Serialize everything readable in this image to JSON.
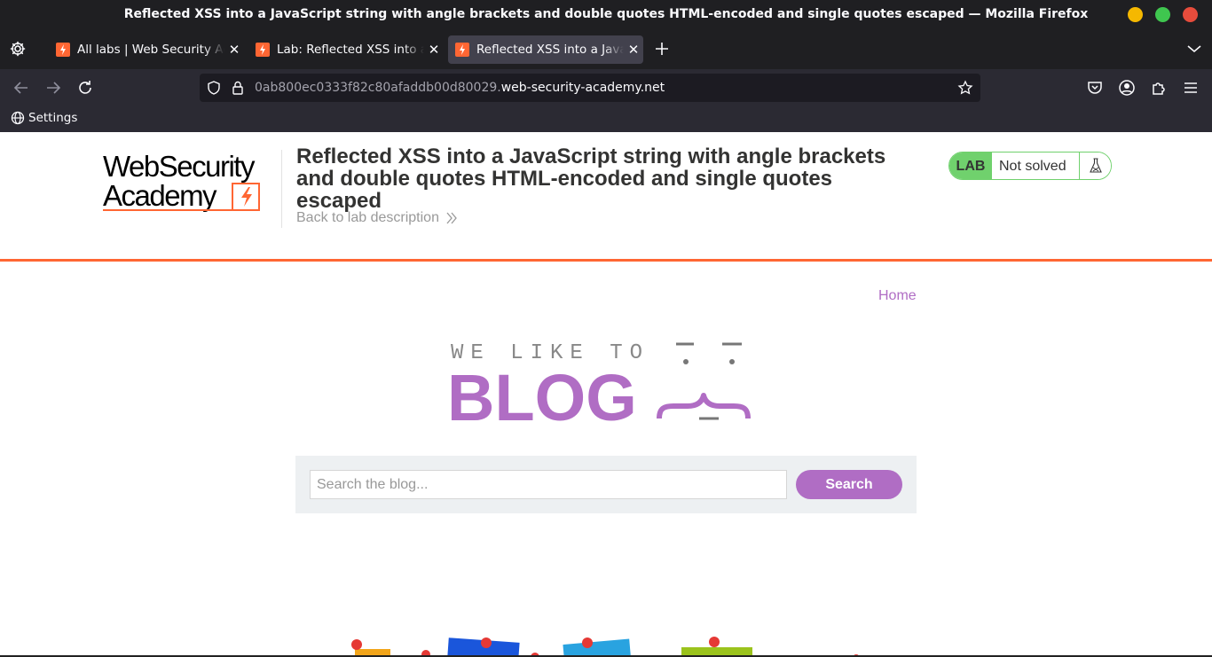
{
  "window": {
    "title": "Reflected XSS into a JavaScript string with angle brackets and double quotes HTML-encoded and single quotes escaped — Mozilla Firefox",
    "controls": {
      "minimize": "#f5b800",
      "maximize": "#3fc64f",
      "close": "#e74c3c"
    }
  },
  "tabs": [
    {
      "label": "All labs | Web Security Academy",
      "active": false
    },
    {
      "label": "Lab: Reflected XSS into a JavaScript string",
      "active": false
    },
    {
      "label": "Reflected XSS into a JavaScript string",
      "active": true
    }
  ],
  "urlbar": {
    "subdomain": "0ab800ec0333f82c80afaddb00d80029.",
    "domain": "web-security-academy.net"
  },
  "bookmarks": [
    {
      "label": "Settings"
    }
  ],
  "lab_header": {
    "logo_line1": "WebSecurity",
    "logo_line2": "Academy",
    "title": "Reflected XSS into a JavaScript string with angle brackets and double quotes HTML-encoded and single quotes escaped",
    "back_link": "Back to lab description",
    "badge": "LAB",
    "status": "Not solved"
  },
  "nav": {
    "home": "Home"
  },
  "blog_logo": {
    "tagline": "WE LIKE TO",
    "word": "BLOG"
  },
  "search": {
    "placeholder": "Search the blog...",
    "button": "Search"
  },
  "colors": {
    "accent_orange": "#ff6633",
    "lab_green": "#70d16d",
    "blog_purple": "#b06dc4",
    "search_bg": "#edf0f2"
  }
}
